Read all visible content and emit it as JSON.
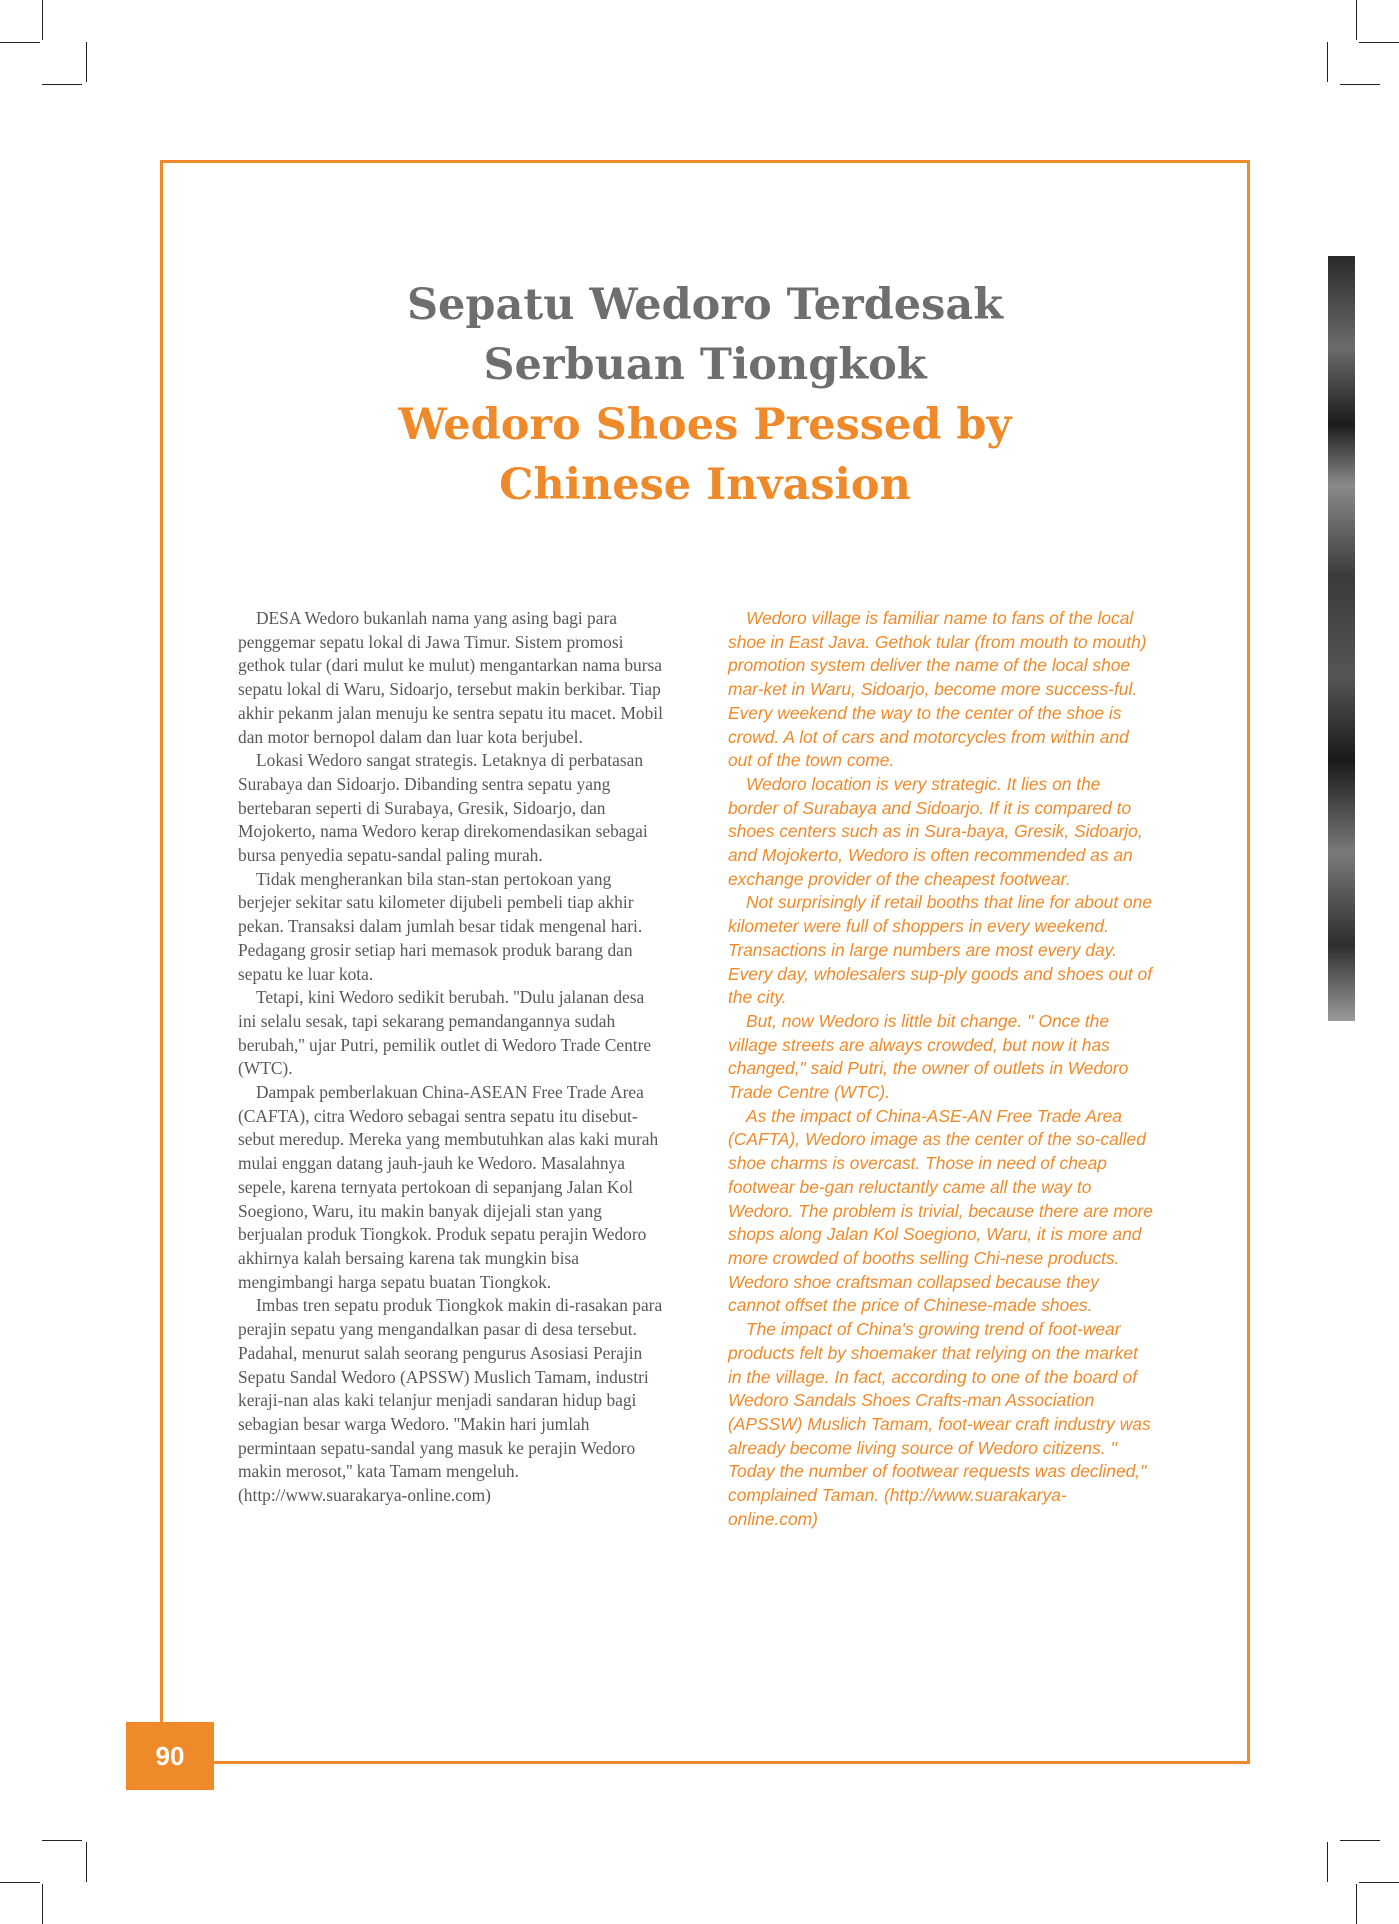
{
  "title": {
    "indonesian_line1": "Sepatu Wedoro Terdesak",
    "indonesian_line2": "Serbuan Tiongkok",
    "english_line1": "Wedoro Shoes Pressed  by",
    "english_line2": "Chinese Invasion"
  },
  "article_id": {
    "paragraphs": [
      "DESA Wedoro bukanlah nama yang asing bagi para penggemar sepatu lokal di Jawa Timur. Sistem promosi gethok tular (dari mulut ke mulut) mengantarkan nama bursa sepatu lokal di Waru, Sidoarjo, tersebut makin berkibar. Tiap akhir pekanm jalan menuju ke sentra sepatu itu macet. Mobil dan motor bernopol dalam dan luar kota berjubel.",
      "Lokasi Wedoro sangat strategis. Letaknya di perbatasan Surabaya dan Sidoarjo. Dibanding sentra sepatu yang bertebaran seperti di Surabaya, Gresik, Sidoarjo, dan Mojokerto, nama Wedoro kerap direkomendasikan sebagai bursa penyedia sepatu-sandal paling murah.",
      "Tidak mengherankan bila stan-stan pertokoan yang berjejer sekitar satu kilometer dijubeli pembeli tiap akhir pekan. Transaksi dalam jumlah besar tidak mengenal hari. Pedagang grosir setiap hari memasok produk barang dan sepatu ke luar kota.",
      "Tetapi, kini Wedoro sedikit berubah. ''Dulu jalanan desa ini selalu sesak, tapi sekarang pemandangannya sudah berubah,'' ujar Putri, pemilik outlet di Wedoro Trade Centre (WTC).",
      "Dampak pemberlakuan China-ASEAN Free Trade Area (CAFTA), citra Wedoro sebagai sentra sepatu itu disebut-sebut meredup. Mereka yang membutuhkan alas kaki murah mulai enggan datang jauh-jauh ke Wedoro. Masalahnya sepele, karena ternyata pertokoan di sepanjang Jalan Kol Soegiono, Waru, itu makin banyak dijejali stan yang berjualan produk Tiongkok. Produk sepatu perajin Wedoro akhirnya kalah bersaing karena tak mungkin bisa mengimbangi harga sepatu buatan Tiongkok.",
      "Imbas tren sepatu produk Tiongkok makin di-rasakan para perajin sepatu yang mengandalkan pasar di desa tersebut. Padahal, menurut salah seorang pengurus Asosiasi Perajin Sepatu Sandal Wedoro (APSSW) Muslich Tamam, industri keraji-nan alas kaki telanjur menjadi sandaran hidup bagi sebagian besar warga Wedoro. ''Makin hari jumlah permintaan sepatu-sandal yang masuk ke perajin Wedoro makin merosot,'' kata Tamam mengeluh. (http://www.suarakarya-online.com)"
    ]
  },
  "article_en": {
    "paragraphs": [
      "Wedoro village is familiar name to fans of the local shoe in East Java. Gethok tular (from mouth to mouth) promotion system deliver the name of the local shoe mar-ket in Waru, Sidoarjo, become more success-ful. Every weekend the way to the center of the shoe is crowd. A lot of cars and motorcycles from within and out of the town come.",
      "Wedoro location is very strategic. It lies on the border of Surabaya and Sidoarjo. If it is compared to shoes centers such as in Sura-baya, Gresik, Sidoarjo, and Mojokerto, Wedoro is often recommended as an exchange provider of the cheapest footwear.",
      "Not surprisingly if retail booths that line for about one kilometer were full of shoppers in every weekend. Transactions in large numbers are most every day. Every day, wholesalers sup-ply goods and shoes out of the city.",
      "But, now Wedoro is little bit change. '' Once the village streets are always crowded, but now it has changed,\" said Putri, the owner of outlets in Wedoro Trade Centre (WTC).",
      "As the impact of China-ASE-AN Free Trade Area (CAFTA), Wedoro image as the center of the so-called shoe charms is overcast. Those in need of cheap footwear be-gan reluctantly came all the way to Wedoro. The problem is trivial, because there are more shops along Jalan Kol Soegiono, Waru, it is more and more crowded of booths selling Chi-nese products. Wedoro shoe craftsman collapsed because they cannot offset the price of Chinese-made shoes.",
      "The impact of China's growing trend of foot-wear products felt by shoemaker that relying on the market in the village. In fact, according to one of the board of Wedoro Sandals Shoes Crafts-man Association (APSSW) Muslich Tamam, foot-wear craft industry was already become living source of Wedoro citizens. '' Today the number of footwear requests was declined,\" complained Taman. (http://www.suarakarya-online.com)"
    ]
  },
  "page_number": "90",
  "colors": {
    "accent": "#ef8a2a",
    "title_gray": "#6e6e6e",
    "body_gray": "#585858"
  }
}
